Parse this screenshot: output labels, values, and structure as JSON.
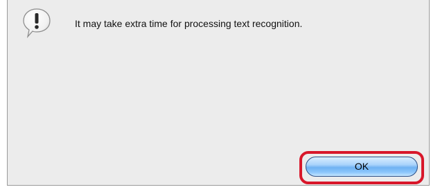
{
  "dialog": {
    "icon": "alert-speech-bubble-icon",
    "message": "It may take extra time for processing text recognition.",
    "ok_label": "OK"
  },
  "colors": {
    "dialog_background": "#ececec",
    "highlight_ring": "#d8172a",
    "button_blue": "#6fb2f2"
  }
}
